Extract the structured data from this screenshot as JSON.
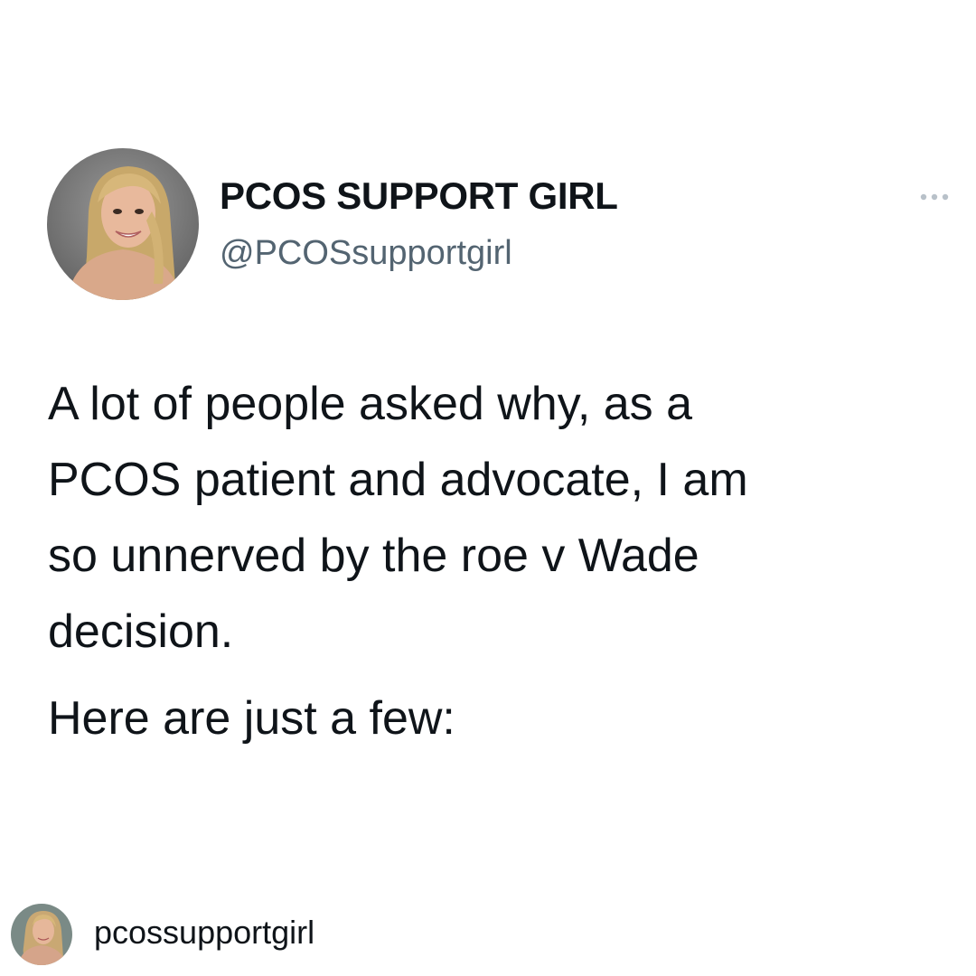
{
  "tweet": {
    "display_name": "PCOS SUPPORT GIRL",
    "handle": "@PCOSsupportgirl",
    "lines": [
      "A lot of people asked why, as a",
      "PCOS patient and advocate, I am",
      "so unnerved by the roe v Wade",
      "decision."
    ],
    "second_paragraph": "Here are just a few:"
  },
  "repost": {
    "username": "pcossupportgirl"
  },
  "icons": {
    "avatar": "profile-photo",
    "more": "more-horizontal-icon"
  },
  "colors": {
    "text": "#0f1419",
    "secondary_text": "#536471",
    "background": "#ffffff"
  }
}
